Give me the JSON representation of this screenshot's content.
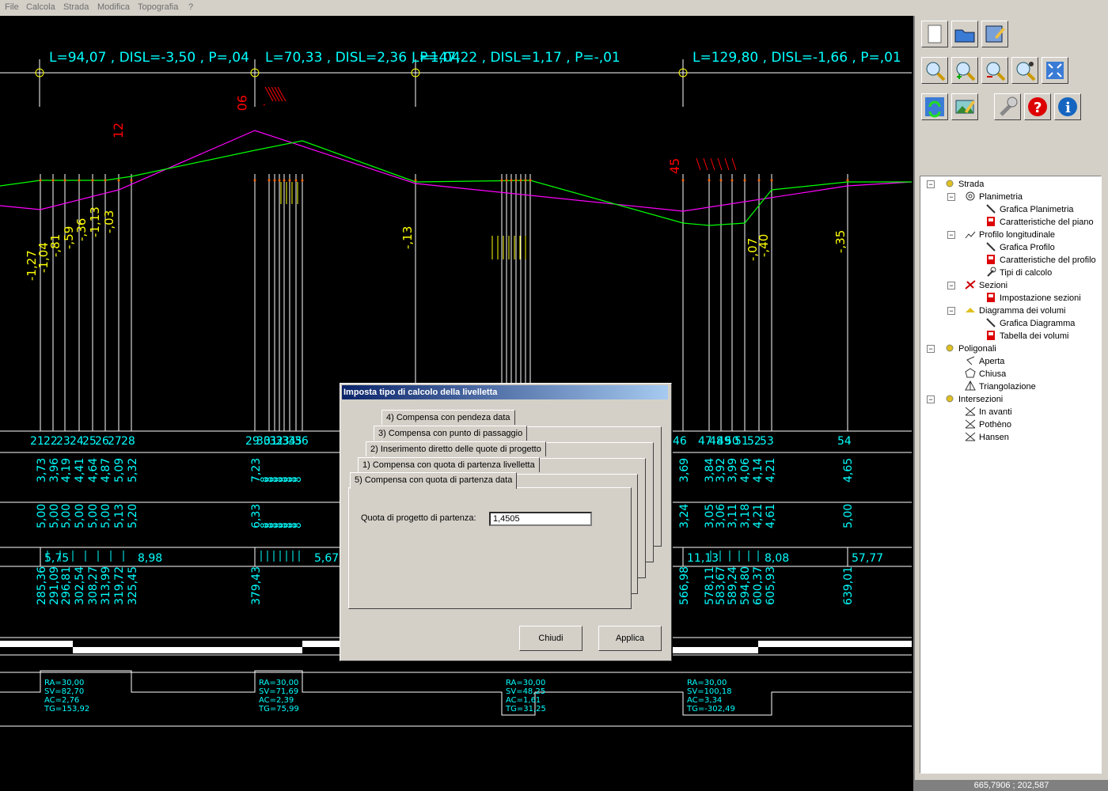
{
  "menu": [
    "File",
    "Calcola",
    "Strada",
    "Modifica",
    "Topografia",
    "?"
  ],
  "colors": {
    "background": "#000000",
    "terrain_line": "#ff00ff",
    "project_line": "#00ff00",
    "grid": "#ffffff",
    "labels_yellow": "#ffff00",
    "labels_red": "#ff0000",
    "labels_cyan": "#00ffff"
  },
  "profile": {
    "segment_labels": [
      "L=94,07  , DISL=-3,50  , P=,04",
      "L=70,33  , DISL=2,36  , P=,04",
      "L=147,22  , DISL=1,17  , P=-,01",
      "L=129,80  , DISL=-1,66  , P=,01"
    ],
    "red_labels": [
      "90",
      "12",
      "45"
    ],
    "yellow_labels": [
      "-1,27",
      "-1,04",
      "-,81",
      "-,59",
      "-,36",
      "-1,13",
      "-,03",
      "-,13",
      "-,07",
      "-,40",
      "-,35"
    ],
    "section_numbers": [
      "21",
      "22",
      "23",
      "24",
      "25",
      "26",
      "27",
      "28",
      "29",
      "30",
      "31",
      "32",
      "33",
      "34",
      "35",
      "36",
      "46",
      "47",
      "48",
      "49",
      "50",
      "51",
      "52",
      "53",
      "54"
    ],
    "terrain_values": [
      "3,73",
      "3,96",
      "4,19",
      "4,41",
      "4,64",
      "4,87",
      "5,09",
      "5,32",
      "7,23",
      "3,69",
      "3,84",
      "3,92",
      "3,99",
      "4,06",
      "4,14",
      "4,21",
      "4,65"
    ],
    "project_values": [
      "5,00",
      "5,00",
      "5,00",
      "5,00",
      "5,00",
      "5,00",
      "5,13",
      "5,20",
      "6,33",
      "3,24",
      "3,05",
      "3,06",
      "3,11",
      "3,18",
      "4,21",
      "4,61",
      "5,00"
    ],
    "partial_distances": [
      "5,75",
      "57,77",
      "11,13",
      "8,98",
      "5,67",
      "8,08"
    ],
    "progressive_distances": [
      "285,36",
      "291,09",
      "296,81",
      "302,54",
      "308,27",
      "313,99",
      "319,72",
      "325,45",
      "379,43",
      "566,98",
      "578,11",
      "583,67",
      "589,24",
      "594,80",
      "600,37",
      "605,93",
      "639,01"
    ],
    "curves": [
      {
        "ra": "RA=30,00",
        "sv": "SV=82,70",
        "ac": "AC=2,76",
        "tg": "TG=153,92"
      },
      {
        "ra": "RA=30,00",
        "sv": "SV=71,69",
        "ac": "AC=2,39",
        "tg": "TG=75,99"
      },
      {
        "ra": "RA=30,00",
        "sv": "SV=48,25",
        "ac": "AC=1,61",
        "tg": "TG=31,25"
      },
      {
        "ra": "RA=30,00",
        "sv": "SV=100,18",
        "ac": "AC=3,34",
        "tg": "TG=-302,49"
      }
    ]
  },
  "tree": [
    {
      "label": "Strada",
      "level": 0,
      "icon": "gear-icon"
    },
    {
      "label": "Planimetria",
      "level": 1,
      "icon": "spiral-icon"
    },
    {
      "label": "Grafica Planimetria",
      "level": 2,
      "icon": "pen-icon"
    },
    {
      "label": "Caratteristiche del piano",
      "level": 2,
      "icon": "red-sheet-icon"
    },
    {
      "label": "Profilo longitudinale",
      "level": 1,
      "icon": "profile-chart-icon"
    },
    {
      "label": "Grafica Profilo",
      "level": 2,
      "icon": "pen-icon"
    },
    {
      "label": "Caratteristiche del profilo",
      "level": 2,
      "icon": "red-sheet-icon"
    },
    {
      "label": "Tipi di calcolo",
      "level": 2,
      "icon": "wrench-icon"
    },
    {
      "label": "Sezioni",
      "level": 1,
      "icon": "section-icon"
    },
    {
      "label": "Impostazione sezioni",
      "level": 2,
      "icon": "red-sheet-icon"
    },
    {
      "label": "Diagramma dei volumi",
      "level": 1,
      "icon": "volume-icon"
    },
    {
      "label": "Grafica Diagramma",
      "level": 2,
      "icon": "pen-icon"
    },
    {
      "label": "Tabella dei volumi",
      "level": 2,
      "icon": "red-sheet-icon"
    },
    {
      "label": "Poligonali",
      "level": 0,
      "icon": "gear-icon"
    },
    {
      "label": "Aperta",
      "level": 1,
      "icon": "open-polygon-icon"
    },
    {
      "label": "Chiusa",
      "level": 1,
      "icon": "closed-polygon-icon"
    },
    {
      "label": "Triangolazione",
      "level": 1,
      "icon": "triangle-icon"
    },
    {
      "label": "Intersezioni",
      "level": 0,
      "icon": "gear-icon"
    },
    {
      "label": "In avanti",
      "level": 1,
      "icon": "intersect-icon"
    },
    {
      "label": "Pothèno",
      "level": 1,
      "icon": "intersect-icon"
    },
    {
      "label": "Hansen",
      "level": 1,
      "icon": "intersect-icon"
    }
  ],
  "toolbar_icons": [
    "new-file-icon",
    "open-folder-icon",
    "save-edit-icon",
    "zoom-icon",
    "zoom-in-icon",
    "zoom-out-icon",
    "zoom-window-icon",
    "zoom-extents-icon",
    "refresh-icon",
    "picture-icon",
    "settings-icon",
    "help-icon",
    "info-icon"
  ],
  "coords": "665,7906 ; 202,587",
  "dialog": {
    "title": "Imposta tipo di calcolo della livelletta",
    "tabs": [
      "4) Compensa con pendeza data",
      "3) Compensa con punto di passaggio",
      "2) Inserimento diretto delle quote di progetto",
      "1) Compensa con quota di partenza livelletta",
      "5) Compensa con quota di partenza data"
    ],
    "field_label": "Quota di progetto di partenza:",
    "field_value": "1,4505",
    "buttons": {
      "close": "Chiudi",
      "apply": "Applica"
    }
  }
}
